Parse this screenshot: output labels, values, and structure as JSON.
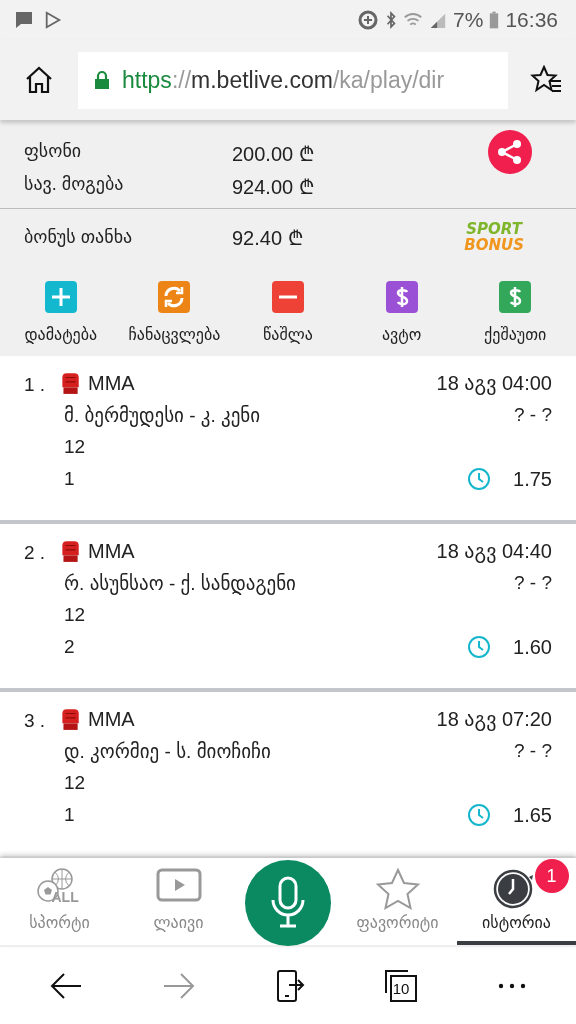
{
  "status_bar": {
    "battery": "7%",
    "time": "16:36"
  },
  "address_bar": {
    "scheme": "https",
    "separator": "://",
    "host": "m.betlive.com",
    "path": "/ka/play/dir"
  },
  "summary": {
    "rows": [
      {
        "label": "ფსონი",
        "value": "200.00 ₾"
      },
      {
        "label": "სავ. მოგება",
        "value": "924.00 ₾"
      }
    ],
    "bonus": {
      "label": "ბონუს თანხა",
      "value": "92.40 ₾",
      "logo": [
        "SPORT",
        "BONUS"
      ]
    }
  },
  "actions": [
    {
      "kind": "add",
      "label": "დამატება",
      "color": "#13b8cf"
    },
    {
      "kind": "swap",
      "label": "ჩანაცვლება",
      "color": "#ec8515"
    },
    {
      "kind": "remove",
      "label": "წაშლა",
      "color": "#ef4236"
    },
    {
      "kind": "dollar",
      "label": "ავტო",
      "color": "#9b51d6"
    },
    {
      "kind": "dollar",
      "label": "ქეშაუთი",
      "color": "#34a85a"
    }
  ],
  "bets": [
    {
      "number": "1 .",
      "sport": "MMA",
      "date": "18 აგვ 04:00",
      "match": "მ. ბერმუდესი - კ. კენი",
      "score": "? - ?",
      "market": "12",
      "pick": "1",
      "odds": "1.75"
    },
    {
      "number": "2 .",
      "sport": "MMA",
      "date": "18 აგვ 04:40",
      "match": "რ. ასუნსაო - ქ. სანდაგენი",
      "score": "? - ?",
      "market": "12",
      "pick": "2",
      "odds": "1.60"
    },
    {
      "number": "3 .",
      "sport": "MMA",
      "date": "18 აგვ 07:20",
      "match": "დ. კორმიე - ს. მიოჩიჩი",
      "score": "? - ?",
      "market": "12",
      "pick": "1",
      "odds": "1.65"
    }
  ],
  "bottom_nav": [
    {
      "kind": "sports",
      "label": "სპორტი",
      "icon_text": "ALL",
      "selected": false
    },
    {
      "kind": "live",
      "label": "ლაივი",
      "selected": false
    },
    {
      "kind": "mic"
    },
    {
      "kind": "favorites",
      "label": "ფავორიტი",
      "selected": false
    },
    {
      "kind": "history",
      "label": "ისტორია",
      "badge": "1",
      "selected": true
    }
  ],
  "browser_toolbar": {
    "tab_count": "10"
  }
}
